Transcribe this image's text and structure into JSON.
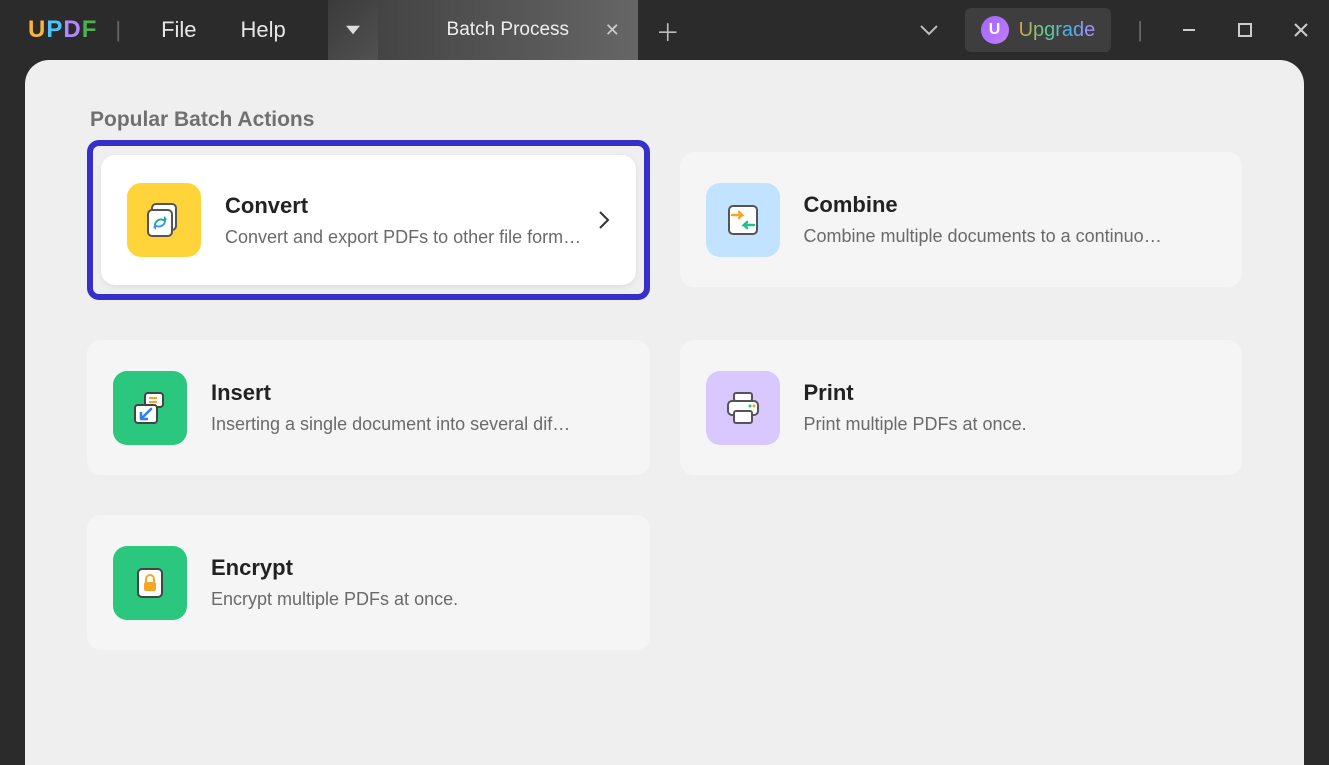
{
  "header": {
    "logo": "UPDF",
    "menu": {
      "file": "File",
      "help": "Help"
    },
    "tab_title": "Batch Process",
    "upgrade_letter": "U",
    "upgrade_label": "Upgrade"
  },
  "main": {
    "section_title": "Popular Batch Actions",
    "cards": {
      "convert": {
        "title": "Convert",
        "desc": "Convert and export PDFs to other file forma…"
      },
      "combine": {
        "title": "Combine",
        "desc": "Combine multiple documents to a continuo…"
      },
      "insert": {
        "title": "Insert",
        "desc": "Inserting a single document into several dif…"
      },
      "print": {
        "title": "Print",
        "desc": "Print multiple PDFs at once."
      },
      "encrypt": {
        "title": "Encrypt",
        "desc": "Encrypt multiple PDFs at once."
      }
    }
  }
}
